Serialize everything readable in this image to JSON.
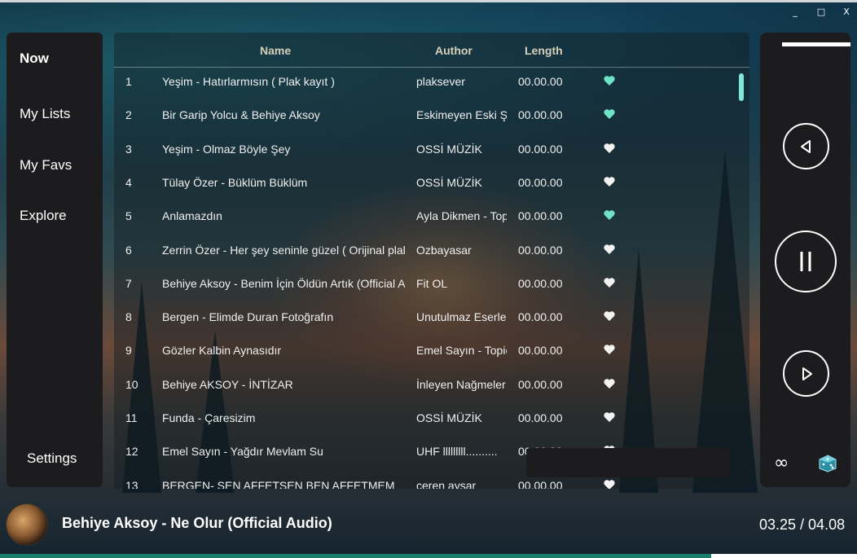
{
  "window": {
    "controls": [
      "_",
      "□",
      "X"
    ]
  },
  "sidebar": {
    "items": [
      {
        "label": "Now",
        "active": true
      },
      {
        "label": "My Lists",
        "active": false
      },
      {
        "label": "My Favs",
        "active": false
      },
      {
        "label": "Explore",
        "active": false
      }
    ],
    "settings_label": "Settings"
  },
  "table": {
    "headers": {
      "name": "Name",
      "author": "Author",
      "length": "Length"
    },
    "rows": [
      {
        "num": "1",
        "name": "Yeşim - Hatırlarmısın ( Plak kayıt )",
        "author": "plaksever",
        "length": "00.00.00",
        "fav": true
      },
      {
        "num": "2",
        "name": "Bir Garip Yolcu &   Behiye Aksoy",
        "author": "Eskimeyen Eski Şarkılar",
        "length": "00.00.00",
        "fav": true
      },
      {
        "num": "3",
        "name": "Yeşim - Olmaz Böyle Şey",
        "author": "OSSİ MÜZİK",
        "length": "00.00.00",
        "fav": false
      },
      {
        "num": "4",
        "name": "Tülay Özer - Büklüm Büklüm",
        "author": "OSSİ MÜZİK",
        "length": "00.00.00",
        "fav": false
      },
      {
        "num": "5",
        "name": "Anlamazdın",
        "author": "Ayla Dikmen - Topic",
        "length": "00.00.00",
        "fav": true
      },
      {
        "num": "6",
        "name": "Zerrin Özer - Her şey seninle güzel ( Orijinal plak )",
        "author": "Ozbayasar",
        "length": "00.00.00",
        "fav": false
      },
      {
        "num": "7",
        "name": "Behiye Aksoy - Benim İçin Öldün Artık (Official Audio)",
        "author": "Fit OL",
        "length": "00.00.00",
        "fav": false
      },
      {
        "num": "8",
        "name": "Bergen - Elimde Duran Fotoğrafın",
        "author": "Unutulmaz Eserler",
        "length": "00.00.00",
        "fav": false
      },
      {
        "num": "9",
        "name": "Gözler Kalbin Aynasıdır",
        "author": "Emel Sayın - Topic",
        "length": "00.00.00",
        "fav": false
      },
      {
        "num": "10",
        "name": "Behiye AKSOY - İNTİZAR",
        "author": "İnleyen Nağmeler",
        "length": "00.00.00",
        "fav": false
      },
      {
        "num": "11",
        "name": "Funda - Çaresizim",
        "author": "OSSİ MÜZİK",
        "length": "00.00.00",
        "fav": false
      },
      {
        "num": "12",
        "name": "Emel Sayın - Yağdır Mevlam Su",
        "author": "UHF lllllllll..........",
        "length": "00.00.00",
        "fav": false
      },
      {
        "num": "13",
        "name": "BERGEN- SEN AFFETSEN BEN AFFETMEM",
        "author": "ceren aysar",
        "length": "00.00.00",
        "fav": false
      }
    ]
  },
  "colors": {
    "fav_on": "#6ee3c6",
    "fav_off": "#f2f2f2",
    "accent": "#1a7e6a"
  },
  "player": {
    "volume_level": 1.0,
    "icons": {
      "prev": "prev-icon",
      "pause": "pause-icon",
      "next": "next-icon",
      "loop": "infinity-icon",
      "shuffle": "dice-icon"
    }
  },
  "now_playing": {
    "title": "Behiye Aksoy - Ne Olur (Official Audio)",
    "time": "03.25 / 04.08",
    "progress": 0.83
  }
}
